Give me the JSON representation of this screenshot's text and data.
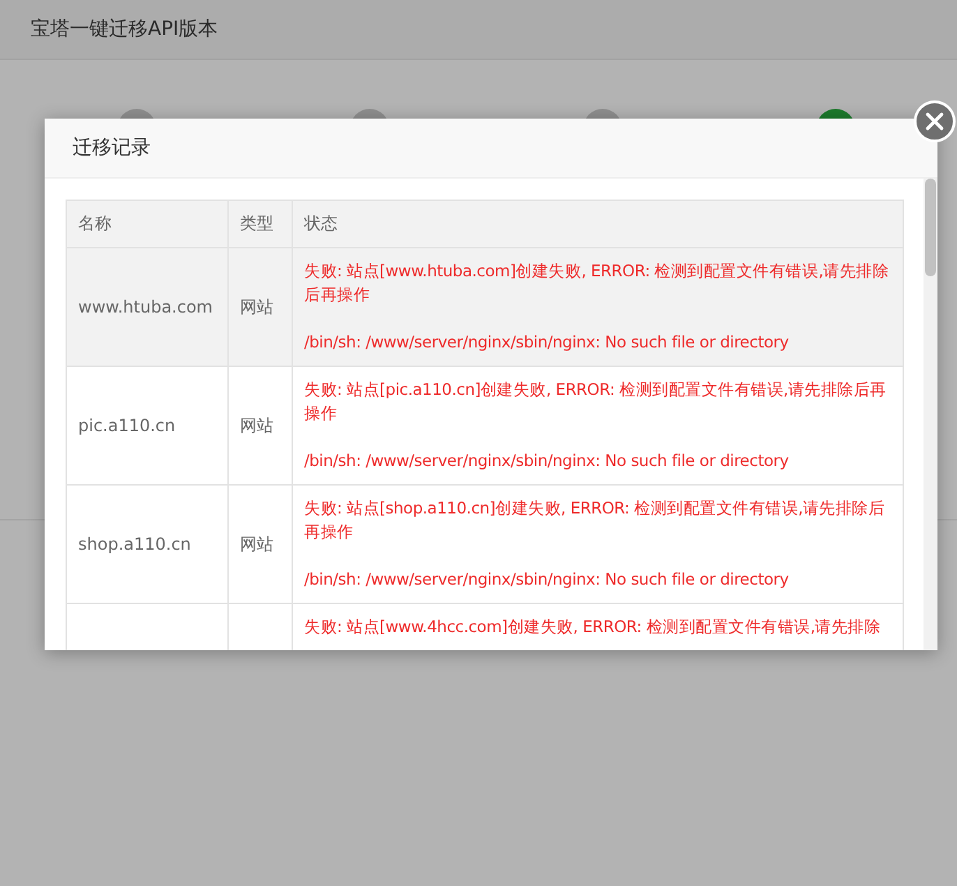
{
  "page": {
    "title": "宝塔一键迁移API版本"
  },
  "steps": [
    {
      "done": false
    },
    {
      "done": false
    },
    {
      "done": false
    },
    {
      "done": true
    }
  ],
  "dialog": {
    "title": "迁移记录",
    "table": {
      "columns": [
        "名称",
        "类型",
        "状态"
      ],
      "rows": [
        {
          "name": "www.htuba.com",
          "type": "网站",
          "highlighted": true,
          "message": "失败: 站点[www.htuba.com]创建失败, ERROR: 检测到配置文件有错误,请先排除后再操作",
          "detail": "/bin/sh: /www/server/nginx/sbin/nginx: No such file or directory"
        },
        {
          "name": "pic.a110.cn",
          "type": "网站",
          "highlighted": false,
          "message": "失败: 站点[pic.a110.cn]创建失败, ERROR: 检测到配置文件有错误,请先排除后再操作",
          "detail": "/bin/sh: /www/server/nginx/sbin/nginx: No such file or directory"
        },
        {
          "name": "shop.a110.cn",
          "type": "网站",
          "highlighted": false,
          "message": "失败: 站点[shop.a110.cn]创建失败, ERROR: 检测到配置文件有错误,请先排除后再操作",
          "detail": "/bin/sh: /www/server/nginx/sbin/nginx: No such file or directory"
        },
        {
          "highlighted": false,
          "message": "失败: 站点[www.4hcc.com]创建失败, ERROR: 检测到配置文件有错误,请先排除"
        }
      ]
    }
  }
}
